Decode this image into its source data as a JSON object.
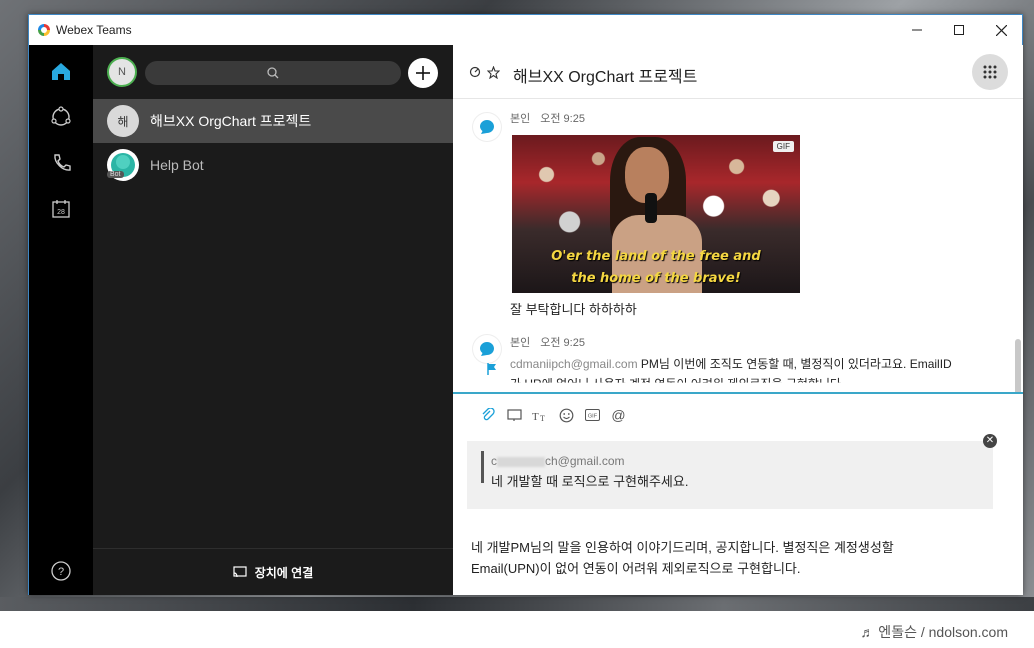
{
  "window": {
    "title": "Webex Teams"
  },
  "user": {
    "initial": "N"
  },
  "conversations": [
    {
      "avatar": "해",
      "name": "해브XX OrgChart 프로젝트",
      "active": true
    },
    {
      "avatar": "",
      "name": "Help Bot",
      "badge": "Bot",
      "active": false
    }
  ],
  "rail": {
    "calendar_day": "28"
  },
  "list_footer": {
    "label": "장치에 연결"
  },
  "chat": {
    "title": "해브XX OrgChart 프로젝트",
    "messages": [
      {
        "sender": "본인",
        "time": "오전 9:25",
        "gif_badge": "GIF",
        "gif_caption_1": "O'er the land of the free and",
        "gif_caption_2": "the home of the brave!",
        "text": "잘 부탁합니다 하하하하"
      },
      {
        "sender": "본인",
        "time": "오전 9:25",
        "email": "cdmaniipch@gmail.com",
        "text": "PM님 이번에 조직도 연동할 때, 별정직이 있더라고요. EmailID",
        "text2": "가 HR에 없어니 사용자 계정 연동이 어려워 제외로직을 구현합니다."
      }
    ]
  },
  "composer": {
    "quote_email_prefix": "c",
    "quote_email_suffix": "ch@gmail.com",
    "quote_text": "네 개발할 때 로직으로 구현해주세요.",
    "draft_line1": "네 개발PM님의 말을 인용하여 이야기드리며, 공지합니다. 별정직은 계정생성할",
    "draft_line2": "Email(UPN)이 없어 연동이 어려워 제외로직으로 구현합니다."
  },
  "watermark": "♬ 엔돌슨 / ndolson.com"
}
